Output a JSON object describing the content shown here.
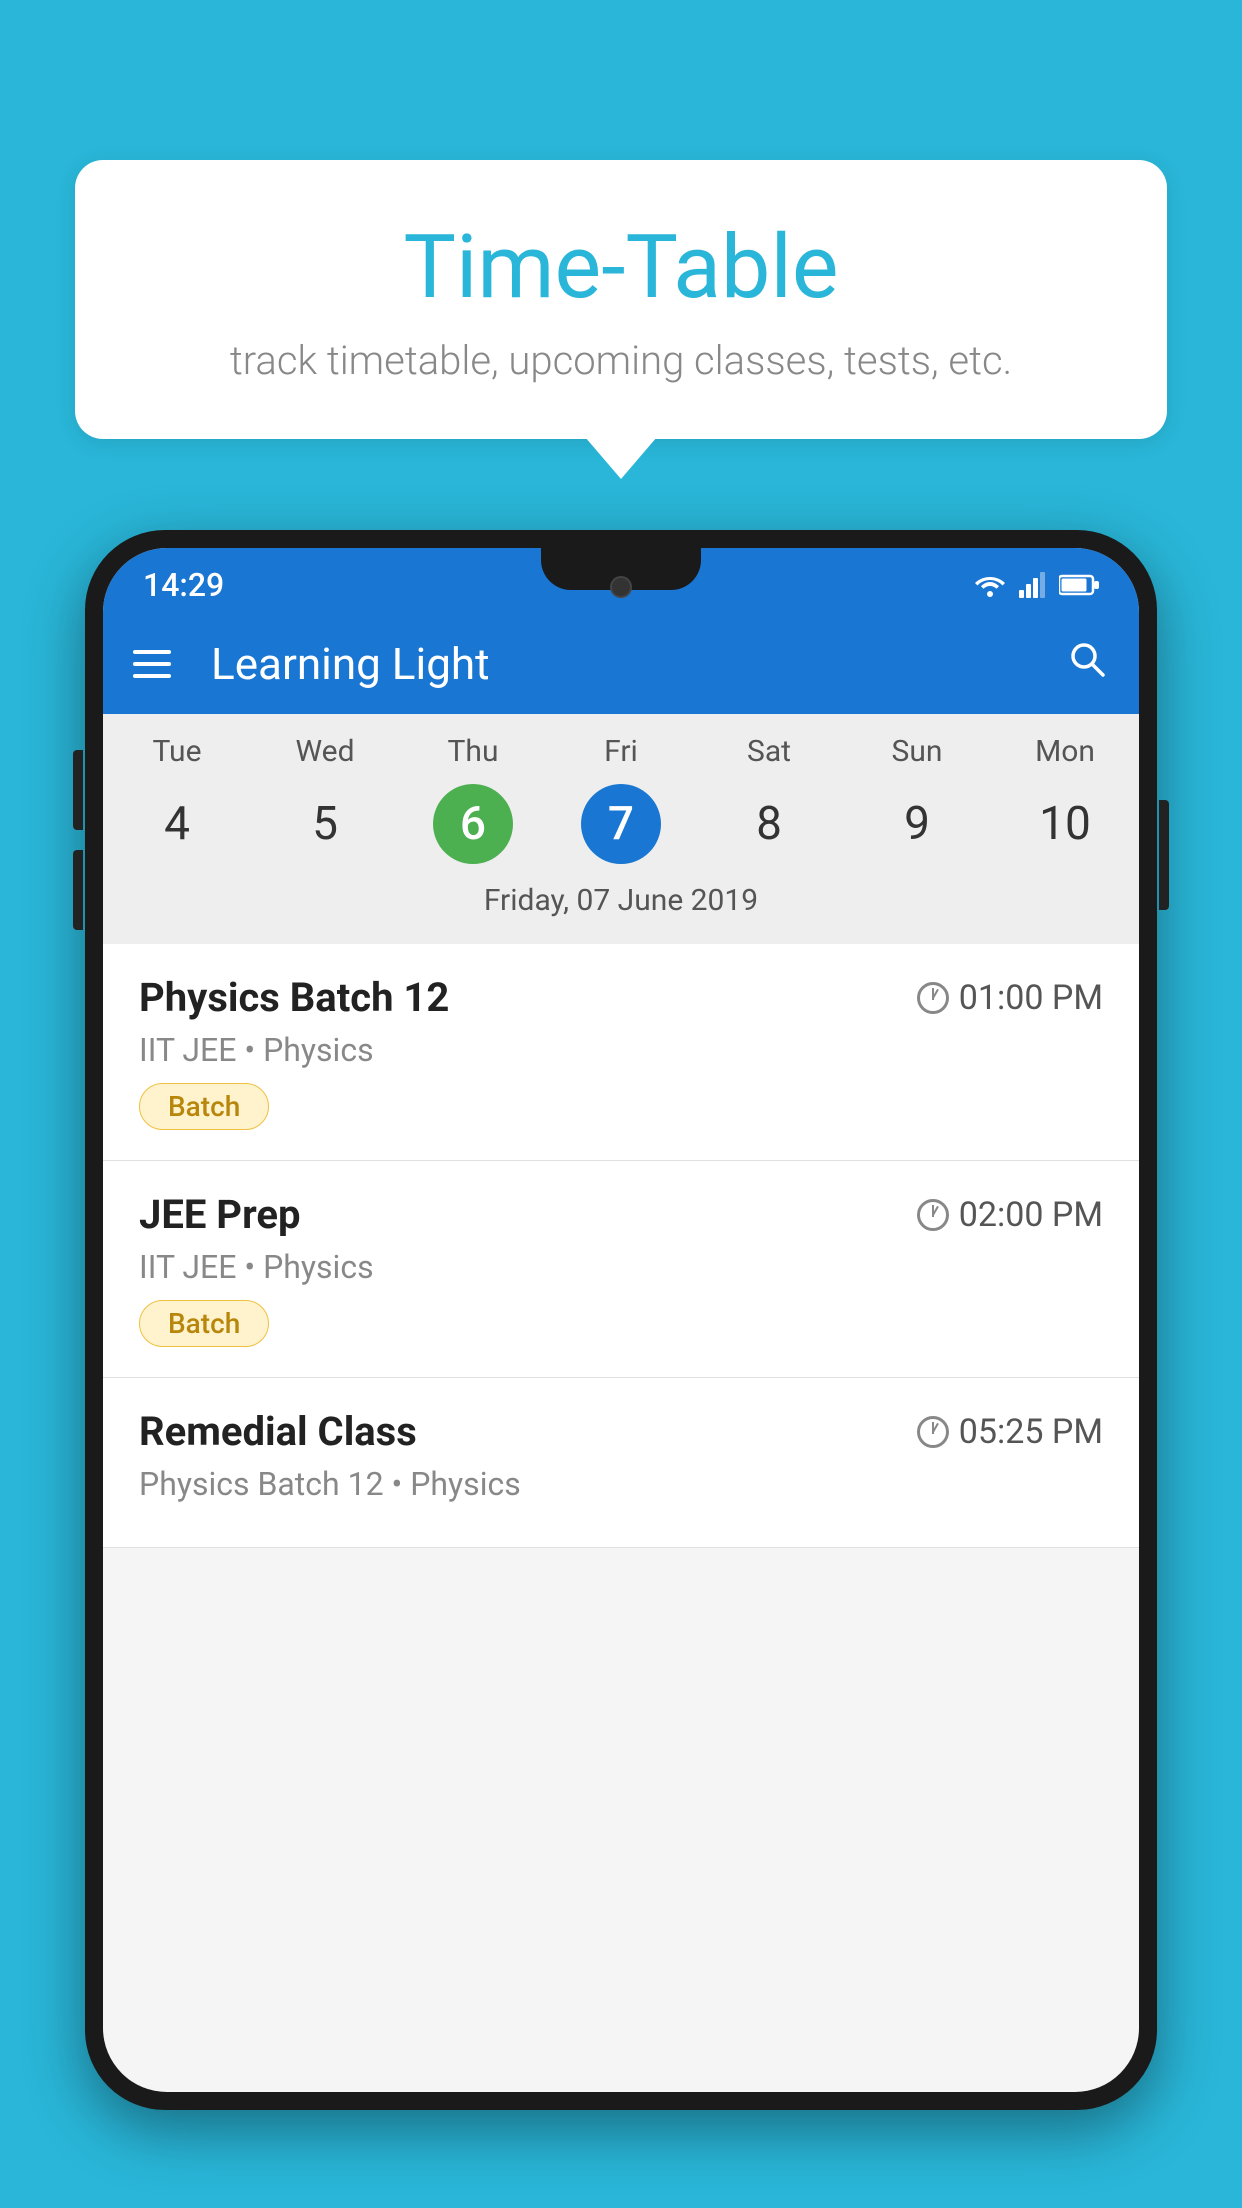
{
  "background_color": "#29b6d8",
  "tooltip": {
    "title": "Time-Table",
    "subtitle": "track timetable, upcoming classes, tests, etc."
  },
  "phone": {
    "status_bar": {
      "time": "14:29"
    },
    "app_bar": {
      "title": "Learning Light"
    },
    "calendar": {
      "days": [
        {
          "label": "Tue",
          "num": "4"
        },
        {
          "label": "Wed",
          "num": "5"
        },
        {
          "label": "Thu",
          "num": "6",
          "state": "today"
        },
        {
          "label": "Fri",
          "num": "7",
          "state": "selected"
        },
        {
          "label": "Sat",
          "num": "8"
        },
        {
          "label": "Sun",
          "num": "9"
        },
        {
          "label": "Mon",
          "num": "10"
        }
      ],
      "selected_date": "Friday, 07 June 2019"
    },
    "schedule": [
      {
        "title": "Physics Batch 12",
        "time": "01:00 PM",
        "subtitle": "IIT JEE • Physics",
        "badge": "Batch"
      },
      {
        "title": "JEE Prep",
        "time": "02:00 PM",
        "subtitle": "IIT JEE • Physics",
        "badge": "Batch"
      },
      {
        "title": "Remedial Class",
        "time": "05:25 PM",
        "subtitle": "Physics Batch 12 • Physics",
        "badge": ""
      }
    ]
  }
}
